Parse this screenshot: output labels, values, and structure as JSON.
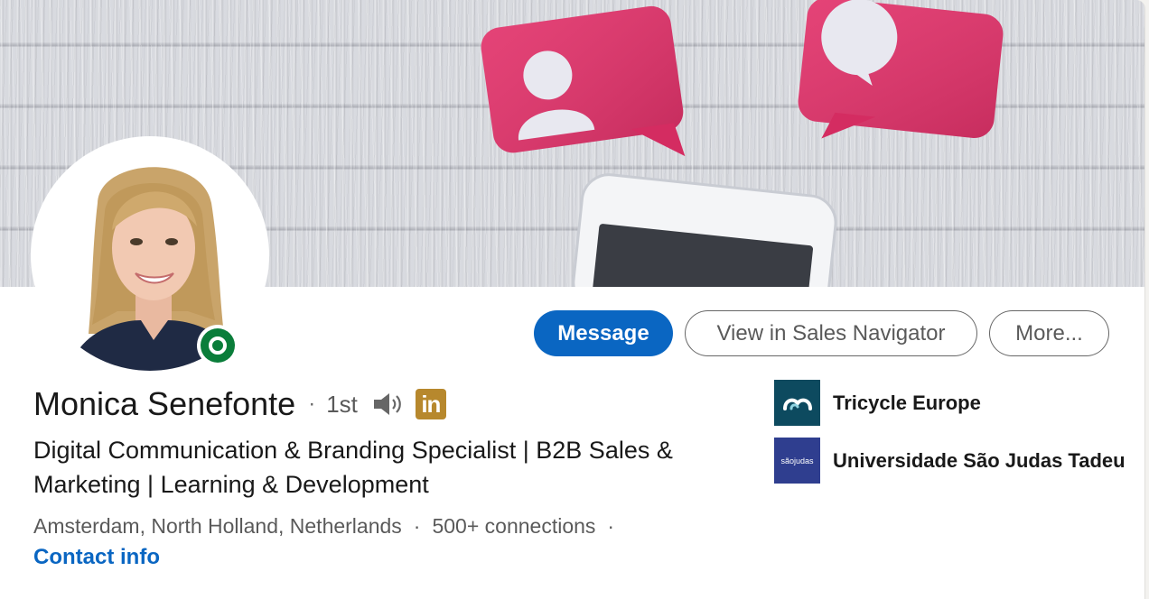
{
  "profile": {
    "name": "Monica Senefonte",
    "separator": "·",
    "degree": "1st",
    "linkedin_badge": "in",
    "headline": "Digital Communication & Branding Specialist | B2B Sales & Marketing | Learning & Development",
    "location": "Amsterdam, North Holland, Netherlands",
    "connections": "500+ connections",
    "contact_info_label": "Contact info",
    "presence_status": "online"
  },
  "actions": {
    "message_label": "Message",
    "sales_navigator_label": "View in Sales Navigator",
    "more_label": "More..."
  },
  "organizations": [
    {
      "name": "Tricycle Europe",
      "logo_icon": "tricycle-europe-logo"
    },
    {
      "name": "Universidade São Judas Tadeu",
      "logo_icon": "usjt-logo",
      "logo_text": "sãojudas"
    }
  ],
  "banner": {
    "description_icons": [
      "profile-speech-bubble-icon",
      "chat-speech-bubble-icon",
      "smartphone-icon"
    ]
  },
  "colors": {
    "primary": "#0a66c2",
    "presence_green": "#0a7d3a",
    "badge_gold": "#b7882d",
    "bubble_pink": "#e2336b"
  },
  "icons": {
    "speaker": "speaker-icon",
    "presence": "online-presence-icon"
  }
}
